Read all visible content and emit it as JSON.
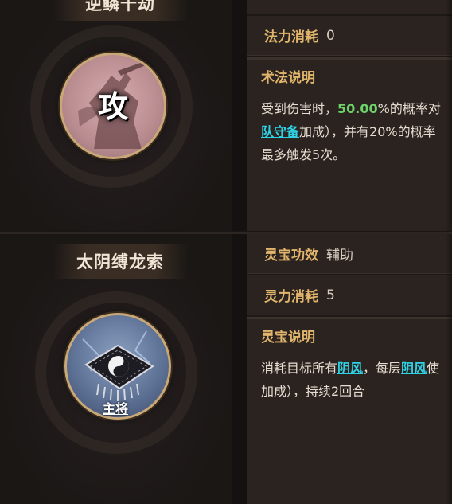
{
  "top_card": {
    "title": "逆鳞千劫",
    "type_char": "攻",
    "mana_cost_label": "法力消耗",
    "mana_cost_value": "0",
    "desc_title": "术法说明",
    "desc_line1_pre": "受到伤害时，",
    "desc_line1_percent": "50.00",
    "desc_line1_post": "%的概率对",
    "desc_line2_link": "队守备",
    "desc_line2_post": "加成），并有20%的概率",
    "desc_line3": "最多触发5次。"
  },
  "bottom_card": {
    "title": "太阴缚龙索",
    "role_label": "主将",
    "effect_label": "灵宝功效",
    "effect_value": "辅助",
    "spirit_cost_label": "灵力消耗",
    "spirit_cost_value": "5",
    "desc_title": "灵宝说明",
    "desc_line1_pre": "消耗目标所有",
    "desc_line1_link1": "阴风",
    "desc_line1_mid": "，每层",
    "desc_line1_link2": "阴风",
    "desc_line1_post": "使",
    "desc_line2": "加成），持续2回合"
  },
  "colors": {
    "accent_gold": "#e2b56c",
    "highlight_green": "#6ed26a",
    "link_cyan": "#2fd3e6"
  },
  "icons": {
    "attack_medal": "attack-skill-icon",
    "treasure_medal": "yin-yang-flag-icon"
  }
}
